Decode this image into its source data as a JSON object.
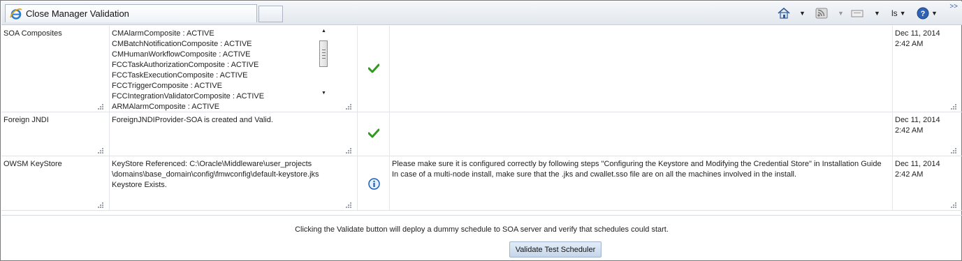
{
  "browser": {
    "tab_title": "Close Manager Validation",
    "overflow_glyph": ">>",
    "page_menu_partial": "ls",
    "dropdown_caret": "▼",
    "icons": [
      "ie-icon",
      "home-icon",
      "rss-feed-icon",
      "print-icon",
      "help-icon"
    ]
  },
  "rows": [
    {
      "name": "SOA Composites",
      "details": [
        "CMAlarmComposite : ACTIVE",
        "CMBatchNotificationComposite : ACTIVE",
        "CMHumanWorkflowComposite : ACTIVE",
        "FCCTaskAuthorizationComposite : ACTIVE",
        "FCCTaskExecutionComposite : ACTIVE",
        "FCCTriggerComposite : ACTIVE",
        "FCCIntegrationValidatorComposite : ACTIVE",
        "ARMAlarmComposite : ACTIVE"
      ],
      "status": "success-check-icon",
      "action": [
        "",
        ""
      ],
      "date": "Dec 11, 2014",
      "time": "2:42 AM"
    },
    {
      "name": "Foreign JNDI",
      "details": [
        "ForeignJNDIProvider-SOA is created and Valid."
      ],
      "status": "success-check-icon",
      "action": [
        "",
        ""
      ],
      "date": "Dec 11, 2014",
      "time": "2:42 AM"
    },
    {
      "name": "OWSM KeyStore",
      "details": [
        "KeyStore Referenced: C:\\Oracle\\Middleware\\user_projects",
        "\\domains\\base_domain\\config\\fmwconfig\\default-keystore.jks",
        "Keystore Exists."
      ],
      "status": "info-icon",
      "action": [
        "Please make sure it is configured correctly by following steps \"Configuring the Keystore and Modifying the Credential Store\" in Installation Guide",
        "In case of a multi-node install, make sure that the .jks and cwallet.sso file are on all the machines involved in the install."
      ],
      "date": "Dec 11, 2014",
      "time": "2:42 AM"
    }
  ],
  "footer": {
    "message": "Clicking the Validate button will deploy a dummy schedule to SOA server and verify that schedules could start.",
    "button_label": "Validate Test Scheduler"
  },
  "colors": {
    "success": "#2f9a1e",
    "info": "#1f5fb4",
    "button_bg": "#c5d6ea"
  }
}
